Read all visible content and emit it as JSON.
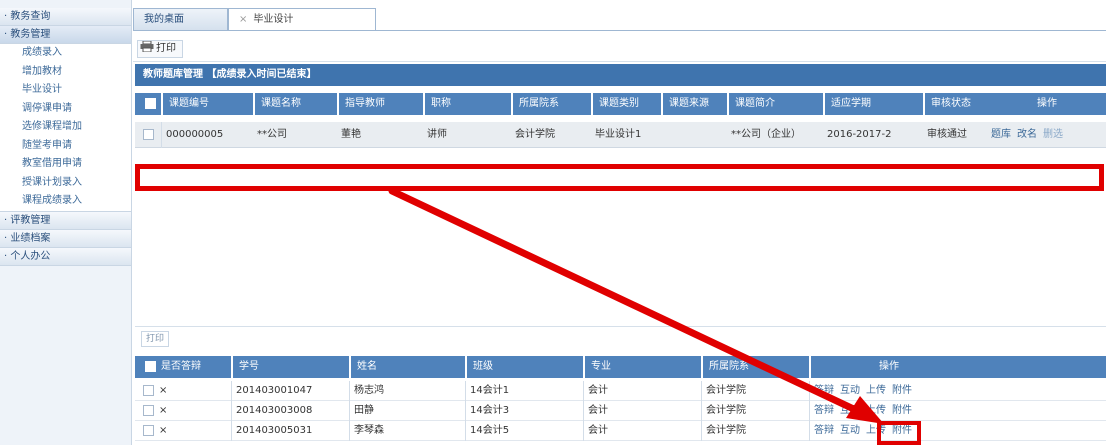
{
  "sidebar": {
    "groups": [
      {
        "label": "· 教务查询"
      },
      {
        "label": "· 教务管理",
        "items": [
          "成绩录入",
          "增加教材",
          "毕业设计",
          "调停课申请",
          "选修课程增加",
          "随堂考申请",
          "教室借用申请",
          "授课计划录入",
          "课程成绩录入"
        ]
      },
      {
        "label": "· 评教管理"
      },
      {
        "label": "· 业绩档案"
      },
      {
        "label": "· 个人办公"
      }
    ]
  },
  "tabs": [
    {
      "label": "我的桌面"
    },
    {
      "label": "毕业设计",
      "close": "×"
    }
  ],
  "toolbar": {
    "print_label": "打印",
    "print_icon": "printer-icon"
  },
  "panel": {
    "title": "教师题库管理 【成绩录入时间已结束】"
  },
  "upper_table": {
    "columns": [
      "课题编号",
      "课题名称",
      "指导教师",
      "职称",
      "所属院系",
      "课题类别",
      "课题来源",
      "课题简介",
      "适应学期",
      "审核状态",
      "操作"
    ],
    "row": {
      "id": "000000005",
      "name": "**公司",
      "teacher": "董艳",
      "title": "讲师",
      "dept": "会计学院",
      "category": "毕业设计1",
      "source": "",
      "intro": "**公司（企业）",
      "term": "2016-2017-2",
      "status": "审核通过",
      "actions": [
        "题库",
        "改名",
        "删选"
      ]
    }
  },
  "lower_toolbar": {
    "print_label": "打印"
  },
  "lower_table": {
    "columns": [
      "是否答辩",
      "学号",
      "姓名",
      "班级",
      "专业",
      "所属院系",
      "操作"
    ],
    "rows": [
      {
        "defense": "×",
        "student_id": "201403001047",
        "name": "杨志鸿",
        "class": "14会计1",
        "major": "会计",
        "dept": "会计学院",
        "actions": [
          "答辩",
          "互动",
          "上传",
          "附件"
        ]
      },
      {
        "defense": "×",
        "student_id": "201403003008",
        "name": "田静",
        "class": "14会计3",
        "major": "会计",
        "dept": "会计学院",
        "actions": [
          "答辩",
          "互动",
          "上传",
          "附件"
        ]
      },
      {
        "defense": "×",
        "student_id": "201403005031",
        "name": "李琴森",
        "class": "14会计5",
        "major": "会计",
        "dept": "会计学院",
        "actions": [
          "答辩",
          "互动",
          "上传",
          "附件"
        ]
      }
    ]
  },
  "colors": {
    "header_blue": "#3f74ae",
    "annotation_red": "#e00000"
  }
}
